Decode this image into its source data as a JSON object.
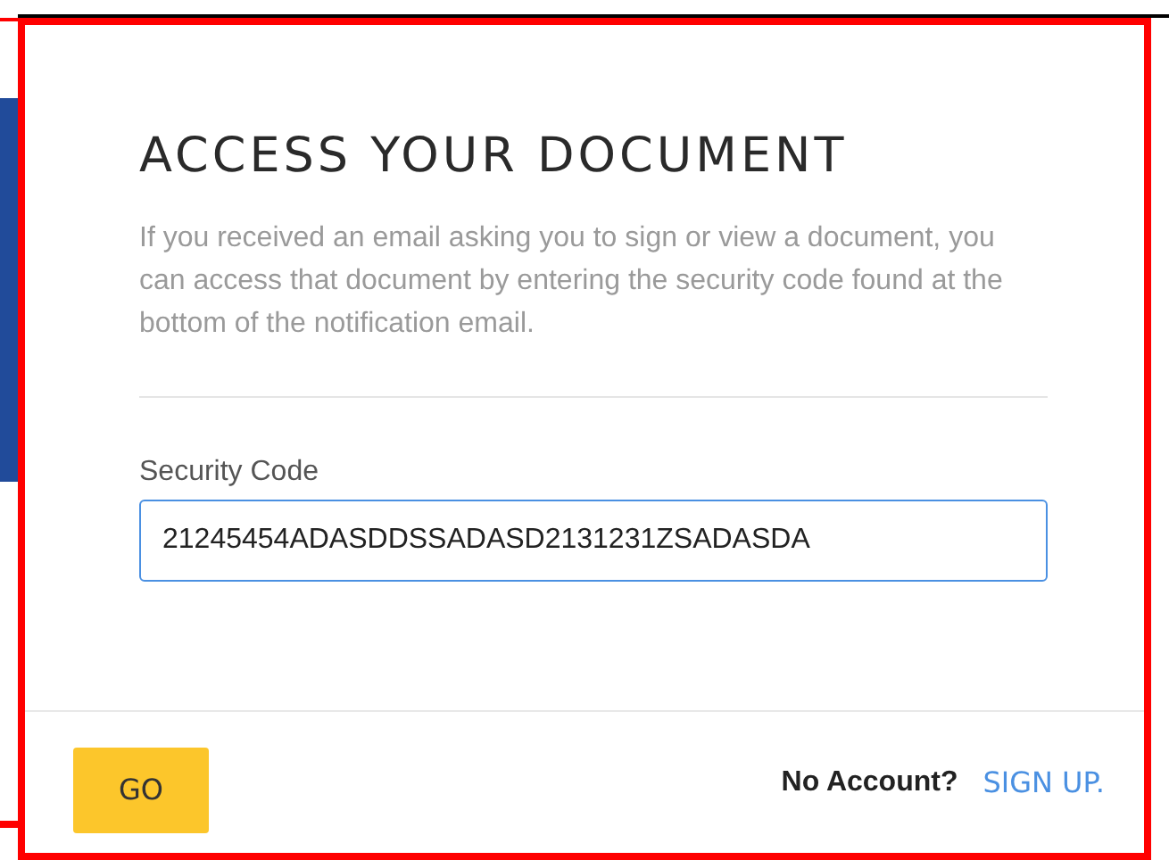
{
  "dialog": {
    "title": "ACCESS YOUR DOCUMENT",
    "description": "If you received an email asking you to sign or view a document, you can access that document by entering the security code found at the bottom of the notification email.",
    "field": {
      "label": "Security Code",
      "value": "21245454ADASDDSSADASD2131231ZSADASDA"
    },
    "footer": {
      "go_button": "GO",
      "no_account": "No Account?",
      "sign_up_link": "SIGN UP."
    }
  }
}
